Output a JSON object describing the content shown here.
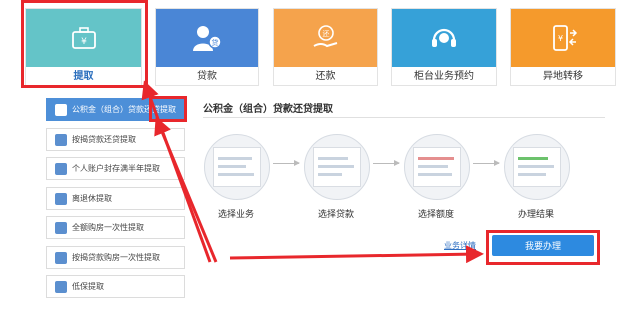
{
  "tiles": [
    {
      "label": "提取",
      "icon": "briefcase-yuan-icon"
    },
    {
      "label": "贷款",
      "icon": "person-loan-icon"
    },
    {
      "label": "还款",
      "icon": "hand-coin-icon"
    },
    {
      "label": "柜台业务预约",
      "icon": "headset-icon"
    },
    {
      "label": "异地转移",
      "icon": "phone-transfer-icon"
    }
  ],
  "menu": [
    {
      "label": "公积金（组合）贷款还贷提取",
      "active": true
    },
    {
      "label": "按揭贷款还贷提取",
      "active": false
    },
    {
      "label": "个人账户封存满半年提取",
      "active": false
    },
    {
      "label": "离退休提取",
      "active": false
    },
    {
      "label": "全额购房一次性提取",
      "active": false
    },
    {
      "label": "按揭贷款购房一次性提取",
      "active": false
    },
    {
      "label": "低保提取",
      "active": false
    }
  ],
  "main": {
    "title": "公积金（组合）贷款还贷提取",
    "steps": [
      "选择业务",
      "选择贷款",
      "选择额度",
      "办理结果"
    ],
    "detail_link": "业务详情",
    "apply_button": "我要办理"
  },
  "colors": {
    "highlight_red": "#e8272c",
    "primary_blue": "#2d8ae0"
  }
}
